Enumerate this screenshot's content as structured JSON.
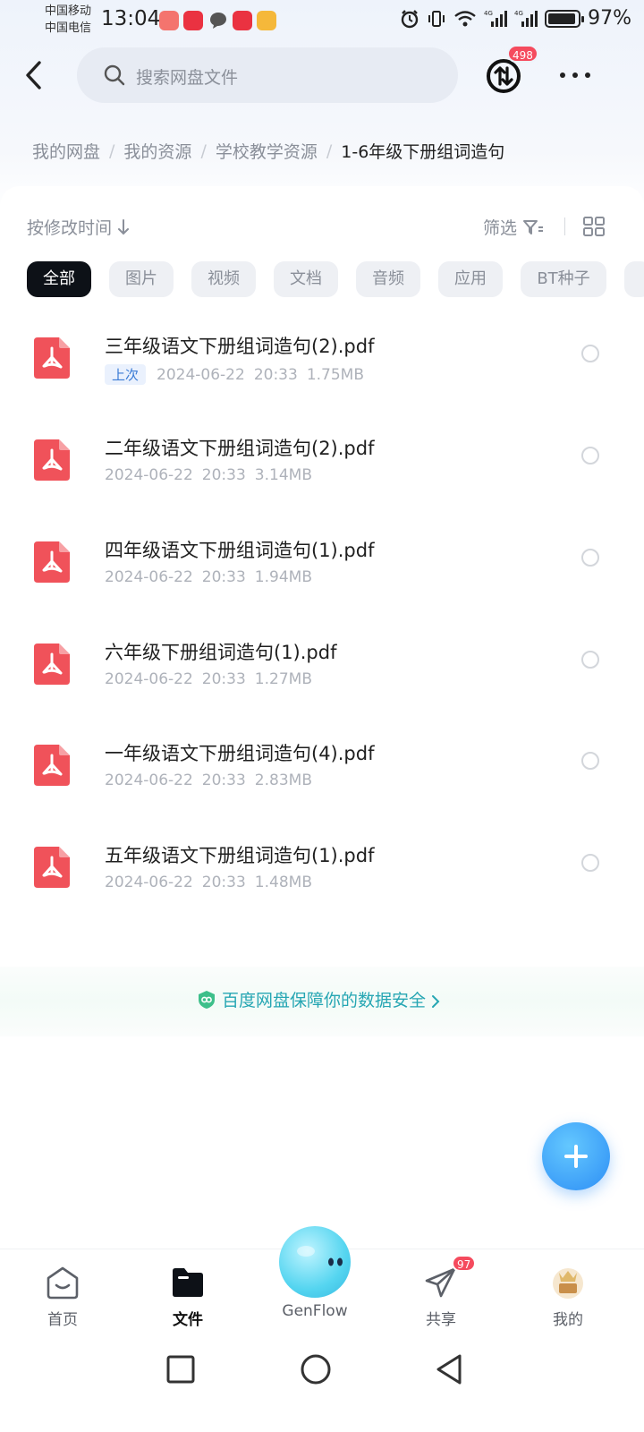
{
  "status_bar": {
    "carrier1": "中国移动",
    "carrier2": "中国电信",
    "time": "13:04",
    "notif_icons": [
      "pinduoduo-icon",
      "xiaohongshu-icon",
      "chat-icon",
      "xiaohongshu-icon",
      "lightning-icon"
    ],
    "right_icons": [
      "alarm-icon",
      "vibrate-icon",
      "wifi-icon",
      "signal-4g-icon",
      "signal-4g-icon"
    ],
    "battery": "97%"
  },
  "header": {
    "search_placeholder": "搜索网盘文件",
    "transfer_badge": "498"
  },
  "breadcrumb": {
    "items": [
      "我的网盘",
      "我的资源",
      "学校教学资源"
    ],
    "current": "1-6年级下册组词造句"
  },
  "toolbar": {
    "sort_label": "按修改时间",
    "filter_label": "筛选"
  },
  "tabs": [
    "全部",
    "图片",
    "视频",
    "文档",
    "音频",
    "应用",
    "BT种子"
  ],
  "files": [
    {
      "name": "三年级语文下册组词造句(2).pdf",
      "tag": "上次",
      "date": "2024-06-22",
      "time": "20:33",
      "size": "1.75MB"
    },
    {
      "name": "二年级语文下册组词造句(2).pdf",
      "tag": "",
      "date": "2024-06-22",
      "time": "20:33",
      "size": "3.14MB"
    },
    {
      "name": "四年级语文下册组词造句(1).pdf",
      "tag": "",
      "date": "2024-06-22",
      "time": "20:33",
      "size": "1.94MB"
    },
    {
      "name": "六年级下册组词造句(1).pdf",
      "tag": "",
      "date": "2024-06-22",
      "time": "20:33",
      "size": "1.27MB"
    },
    {
      "name": "一年级语文下册组词造句(4).pdf",
      "tag": "",
      "date": "2024-06-22",
      "time": "20:33",
      "size": "2.83MB"
    },
    {
      "name": "五年级语文下册组词造句(1).pdf",
      "tag": "",
      "date": "2024-06-22",
      "time": "20:33",
      "size": "1.48MB"
    }
  ],
  "safety_text": "百度网盘保障你的数据安全",
  "bottom_nav": {
    "home": "首页",
    "files": "文件",
    "genflow": "GenFlow",
    "share": "共享",
    "share_badge": "97",
    "mine": "我的"
  },
  "colors": {
    "accent": "#2d8ef5",
    "badge": "#f54b5e",
    "pdf": "#f0525a",
    "safety": "#26a6b3"
  }
}
